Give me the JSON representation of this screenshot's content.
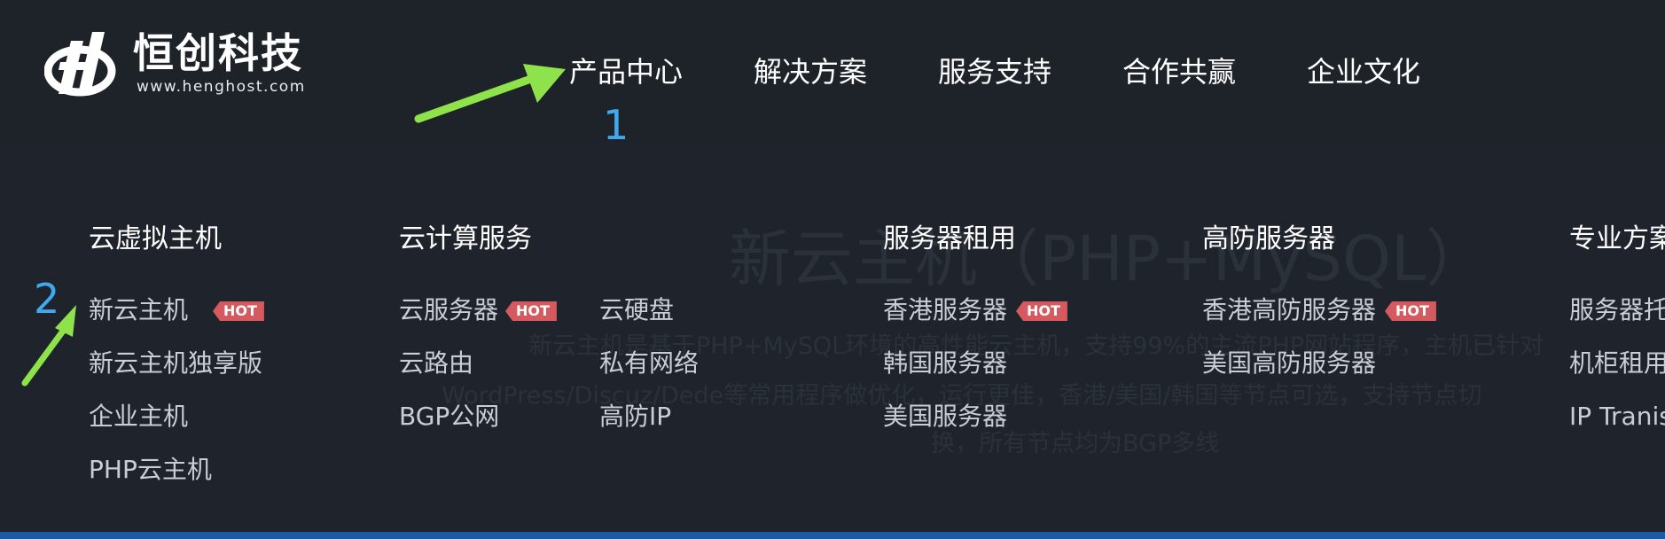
{
  "brand": {
    "name": "恒创科技",
    "url": "www.henghost.com"
  },
  "nav": [
    "产品中心",
    "解决方案",
    "服务支持",
    "合作共赢",
    "企业文化"
  ],
  "annotations": {
    "one": "1",
    "two": "2"
  },
  "background": {
    "headline": "新云主机（PHP+MySQL）",
    "lines": [
      "新云主机是基于PHP+MySQL环境的高性能云主机，支持99%的主流PHP网站程序，主机已针对",
      "WordPress/Discuz/Dede等常用程序做优化，运行更佳，香港/美国/韩国等节点可选，支持节点切",
      "换，所有节点均为BGP多线"
    ]
  },
  "menu": {
    "col1": {
      "title": "云虚拟主机",
      "items": [
        "新云主机",
        "新云主机独享版",
        "企业主机",
        "PHP云主机"
      ]
    },
    "col2": {
      "title": "云计算服务",
      "items": [
        "云服务器",
        "云路由",
        "BGP公网",
        "云硬盘",
        "私有网络",
        "高防IP"
      ]
    },
    "col3": {
      "title": "服务器租用",
      "items": [
        "香港服务器",
        "韩国服务器",
        "美国服务器"
      ]
    },
    "col4": {
      "title": "高防服务器",
      "items": [
        "香港高防服务器",
        "美国高防服务器"
      ]
    },
    "col5": {
      "title": "专业方案",
      "items": [
        "服务器托",
        "机柜租用",
        "IP Tranis"
      ]
    }
  },
  "badges": {
    "hot": "HOT"
  },
  "colors": {
    "arrow": "#8fe34a",
    "annotation_number": "#3fa9f0",
    "hot_badge": "#d45a5f",
    "background": "#1f242c"
  }
}
